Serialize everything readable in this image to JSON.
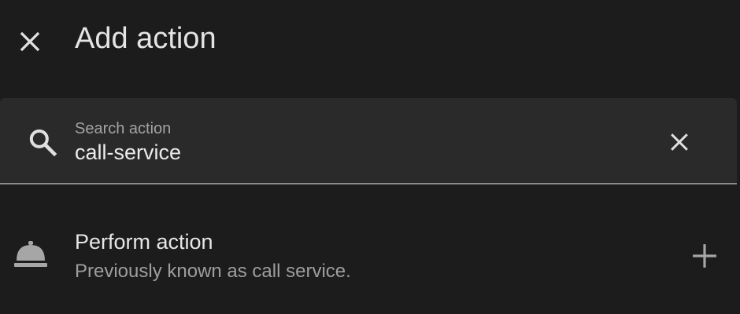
{
  "dialog": {
    "title": "Add action",
    "close_icon": "close-icon"
  },
  "search": {
    "label": "Search action",
    "value": "call-service",
    "search_icon": "search-icon",
    "clear_icon": "clear-icon"
  },
  "results": [
    {
      "icon": "room-service-bell-icon",
      "title": "Perform action",
      "subtitle": "Previously known as call service.",
      "action_icon": "plus-icon"
    }
  ],
  "colors": {
    "background": "#1c1c1c",
    "field_background": "#2a2a2a",
    "field_underline": "#8a8a8a",
    "primary_text": "#e4e4e4",
    "secondary_text": "#9e9e9e",
    "icon": "#e0e0e0",
    "muted_icon": "#a6a6a6"
  }
}
